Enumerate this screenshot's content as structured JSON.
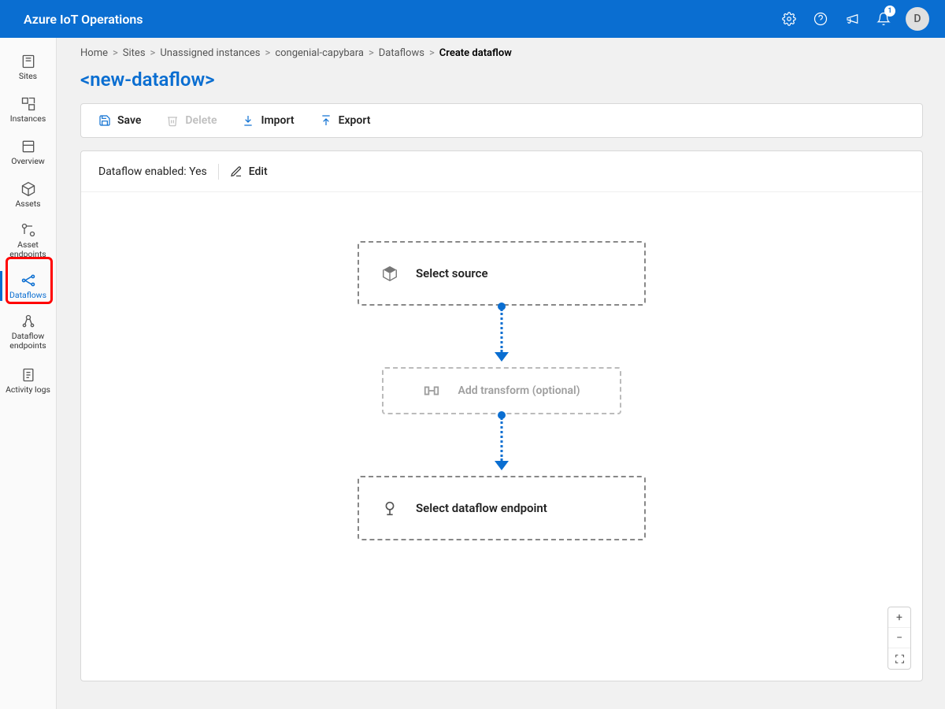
{
  "header": {
    "app_title": "Azure IoT Operations",
    "notification_count": "1",
    "avatar_initial": "D"
  },
  "rail": {
    "items": [
      {
        "label": "Sites"
      },
      {
        "label": "Instances"
      },
      {
        "label": "Overview"
      },
      {
        "label": "Assets"
      },
      {
        "label": "Asset endpoints"
      },
      {
        "label": "Dataflows"
      },
      {
        "label": "Dataflow endpoints"
      },
      {
        "label": "Activity logs"
      }
    ]
  },
  "breadcrumb": {
    "items": [
      "Home",
      "Sites",
      "Unassigned instances",
      "congenial-capybara",
      "Dataflows"
    ],
    "current": "Create dataflow"
  },
  "page": {
    "title": "<new-dataflow>"
  },
  "toolbar": {
    "save": "Save",
    "delete": "Delete",
    "import": "Import",
    "export": "Export"
  },
  "canvas": {
    "enabled_label": "Dataflow enabled: Yes",
    "edit_label": "Edit",
    "node_source": "Select source",
    "node_transform": "Add transform (optional)",
    "node_endpoint": "Select dataflow endpoint"
  },
  "zoom": {
    "in": "+",
    "out": "−",
    "fit": "⛶"
  }
}
